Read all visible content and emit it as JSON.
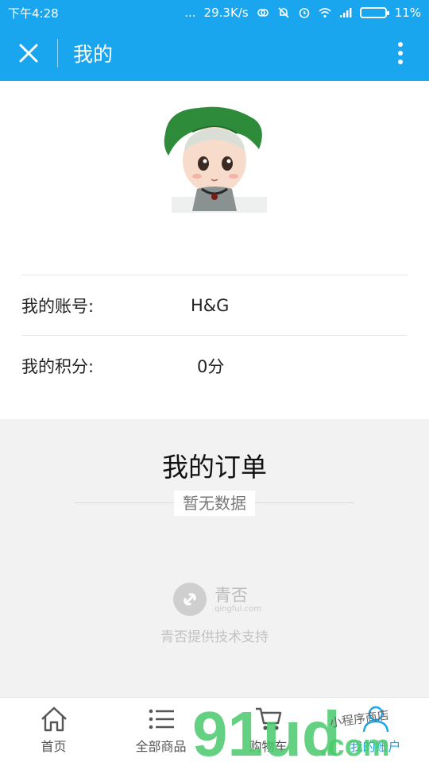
{
  "status": {
    "time": "下午4:28",
    "dots": "...",
    "speed": "29.3K/s",
    "battery": "11%"
  },
  "header": {
    "title": "我的"
  },
  "profile": {
    "account_label": "我的账号:",
    "account_value": "H&G",
    "points_label": "我的积分:",
    "points_value": "0分"
  },
  "orders": {
    "title": "我的订单",
    "empty_text": "暂无数据"
  },
  "brand": {
    "name": "青否",
    "domain": "qingful.com",
    "support": "青否提供技术支持"
  },
  "tabs": [
    {
      "label": "首页",
      "icon": "home-icon"
    },
    {
      "label": "全部商品",
      "icon": "list-icon"
    },
    {
      "label": "购物车",
      "icon": "cart-icon"
    },
    {
      "label": "我的账户",
      "icon": "user-icon"
    }
  ],
  "watermark": {
    "big": "91ud",
    "dot_com": ".com",
    "small": "小程序商店"
  },
  "colors": {
    "primary": "#1aa6ee",
    "background": "#f2f2f2",
    "watermark_green": "#48c96b"
  }
}
